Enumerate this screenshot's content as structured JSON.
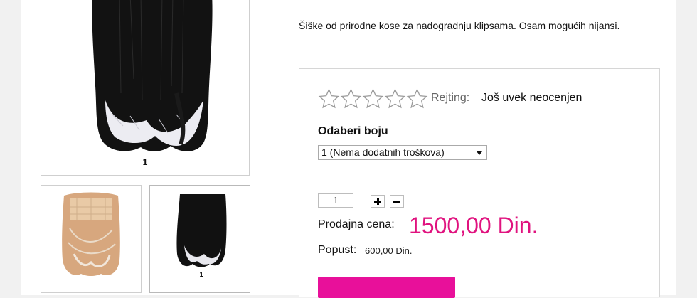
{
  "product": {
    "description": "Šiške od prirodne kose za nadogradnju klipsama. Osam mogućih nijansi.",
    "main_image_caption": "1",
    "thumbnail_2_caption": "1"
  },
  "rating": {
    "stars_total": 5,
    "stars_filled": 0,
    "label": "Rejting:",
    "value": "Još uvek neocenjen"
  },
  "options": {
    "color_label": "Odaberi boju",
    "color_selected": "1 (Nema dodatnih troškova)"
  },
  "quantity": {
    "value": "1"
  },
  "pricing": {
    "sale_label": "Prodajna cena:",
    "sale_value": "1500,00 Din.",
    "discount_label": "Popust:",
    "discount_value": "600,00 Din."
  },
  "colors": {
    "accent_price": "#e0137f",
    "accent_button": "#e8109a"
  }
}
